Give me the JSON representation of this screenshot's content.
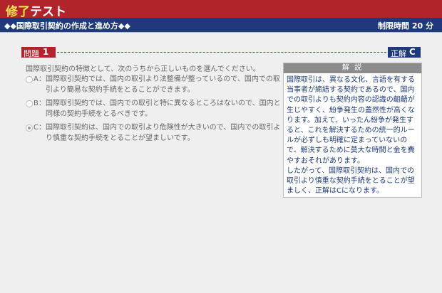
{
  "header": {
    "title_highlight": "修了",
    "title_rest": "テスト",
    "subtitle": "◆◆国際取引契約の作成と進め方◆◆",
    "time_limit": "制限時間 20 分"
  },
  "question": {
    "label": "問題",
    "number": "1",
    "prompt": "国際取引契約の特徴として、次のうちから正しいものを選んでください。",
    "options": [
      {
        "key": "A：",
        "text": "国際取引契約では、国内の取引より法整備が整っているので、国内での取引より簡易な契約手続をとることができます。",
        "selected": false
      },
      {
        "key": "B：",
        "text": "国際取引契約では、国内での取引と特に異なるところはないので、国内と同様の契約手続をとるべきです。",
        "selected": false
      },
      {
        "key": "C：",
        "text": "国際取引契約は、国内での取引より危険性が大きいので、国内での取引より慎重な契約手続をとることが望ましいです。",
        "selected": true
      }
    ]
  },
  "answer": {
    "label": "正解",
    "value": "C"
  },
  "explanation": {
    "heading": "解 説",
    "text": "国際取引は、異なる文化、言語を有する当事者が締結する契約であるので、国内での取引よりも契約内容の認識の齟齬が生じやすく、紛争発生の蓋然性が高くなります。加えて、いったん紛争が発生すると、これを解決するための統一的ルールが必ずしも明確に定まっていないので、解決するために莫大な時間と金を費やすおそれがあります。\nしたがって、国際取引契約は、国内での取引より慎重な契約手続をとることが望ましく、正解はCになります。"
  }
}
